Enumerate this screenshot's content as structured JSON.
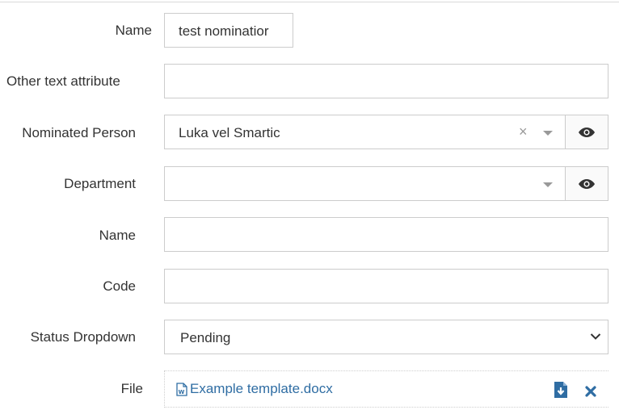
{
  "fields": {
    "name_top": {
      "label": "Name",
      "value": "test nominatior"
    },
    "other_text": {
      "label": "Other text attribute",
      "value": ""
    },
    "nominated_person": {
      "label": "Nominated Person",
      "value": "Luka vel Smartic",
      "clear_glyph": "×"
    },
    "department": {
      "label": "Department",
      "value": ""
    },
    "name": {
      "label": "Name",
      "value": ""
    },
    "code": {
      "label": "Code",
      "value": ""
    },
    "status": {
      "label": "Status Dropdown",
      "value": "Pending"
    },
    "file": {
      "label": "File",
      "filename": "Example template.docx"
    }
  },
  "icons": {
    "eye": "eye-icon",
    "caret": "caret-down-icon",
    "chevron": "chevron-down-icon",
    "word": "word-file-icon",
    "download": "download-file-icon",
    "remove": "remove-x-icon"
  },
  "colors": {
    "link": "#2f6da3",
    "border": "#cccccc",
    "icon_gray": "#999999"
  }
}
